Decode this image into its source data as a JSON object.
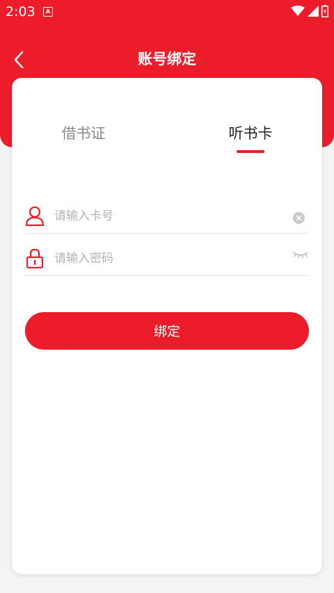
{
  "status_bar": {
    "time": "2:03",
    "notification_icon": "a-icon"
  },
  "header": {
    "title": "账号绑定",
    "back_icon": "chevron-left-icon"
  },
  "tabs": [
    {
      "label": "借书证",
      "selected": false
    },
    {
      "label": "听书卡",
      "selected": true
    }
  ],
  "form": {
    "card_number_placeholder": "请输入卡号",
    "card_number_value": "",
    "password_placeholder": "请输入密码",
    "password_value": ""
  },
  "bind_button_label": "绑定",
  "colors": {
    "accent": "#ed1c2a",
    "background": "#f4f4f4",
    "card": "#ffffff",
    "tab_inactive": "#8a8a8a",
    "placeholder": "#b3b3b3"
  }
}
